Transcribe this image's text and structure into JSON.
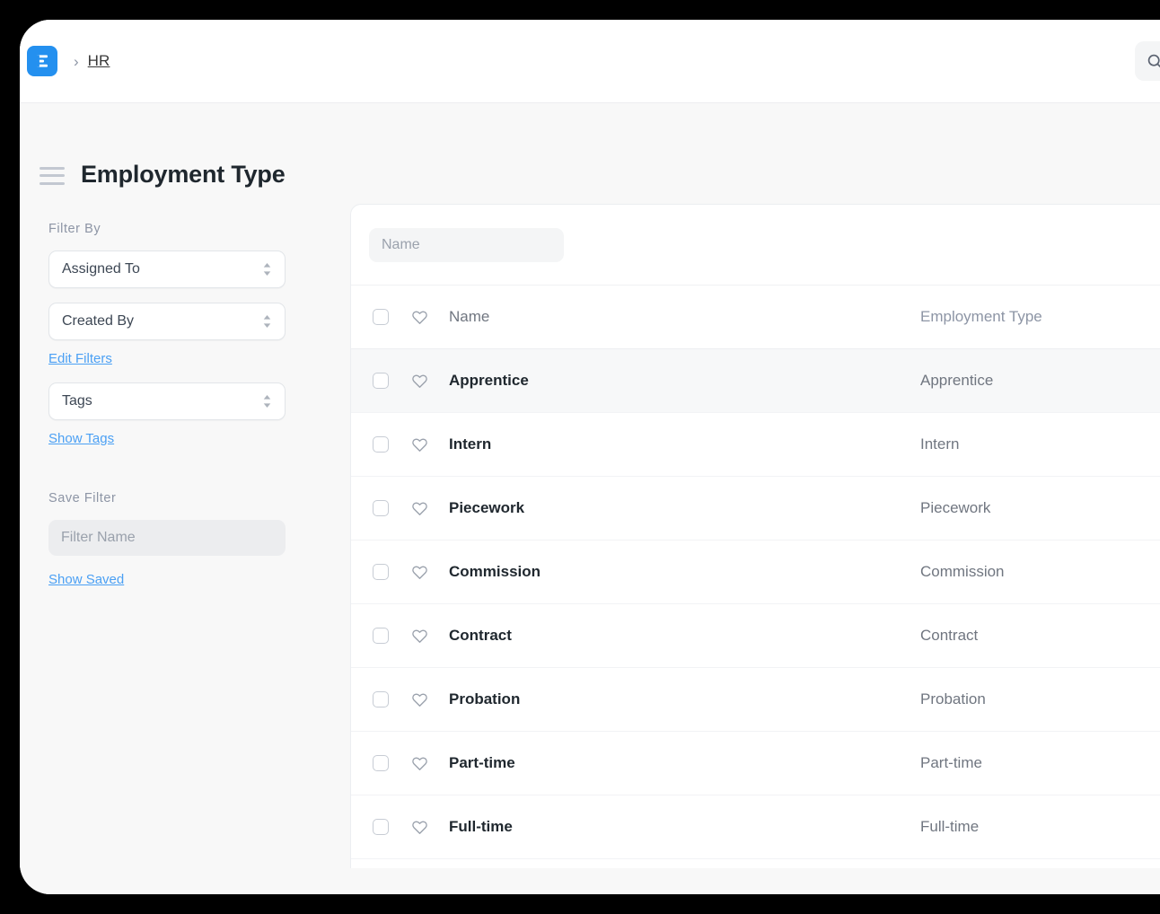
{
  "navbar": {
    "logo_icon": "erpnext-logo-icon",
    "breadcrumb_separator": "›",
    "breadcrumb": "HR",
    "search_icon": "search-icon"
  },
  "page": {
    "menu_icon": "hamburger-menu-icon",
    "title": "Employment Type"
  },
  "sidebar": {
    "filter_by_heading": "Filter By",
    "selects": [
      {
        "label": "Assigned To"
      },
      {
        "label": "Created By"
      }
    ],
    "edit_filters_link": "Edit Filters",
    "tags_select": {
      "label": "Tags"
    },
    "show_tags_link": "Show Tags",
    "save_filter_heading": "Save Filter",
    "filter_name_placeholder": "Filter Name",
    "filter_name_value": "",
    "show_saved_link": "Show Saved"
  },
  "list": {
    "name_filter_placeholder": "Name",
    "name_filter_value": "",
    "columns": {
      "name": "Name",
      "employment_type": "Employment Type"
    },
    "rows": [
      {
        "name": "Apprentice",
        "employment_type": "Apprentice",
        "highlighted": true
      },
      {
        "name": "Intern",
        "employment_type": "Intern",
        "highlighted": false
      },
      {
        "name": "Piecework",
        "employment_type": "Piecework",
        "highlighted": false
      },
      {
        "name": "Commission",
        "employment_type": "Commission",
        "highlighted": false
      },
      {
        "name": "Contract",
        "employment_type": "Contract",
        "highlighted": false
      },
      {
        "name": "Probation",
        "employment_type": "Probation",
        "highlighted": false
      },
      {
        "name": "Part-time",
        "employment_type": "Part-time",
        "highlighted": false
      },
      {
        "name": "Full-time",
        "employment_type": "Full-time",
        "highlighted": false
      }
    ]
  },
  "colors": {
    "brand_blue": "#2490ef",
    "link_blue": "#4ba0f4",
    "page_bg": "#f8f8f8",
    "card_bg": "#ffffff",
    "text_dark": "#1f272e",
    "text_muted": "#8d95a5"
  }
}
